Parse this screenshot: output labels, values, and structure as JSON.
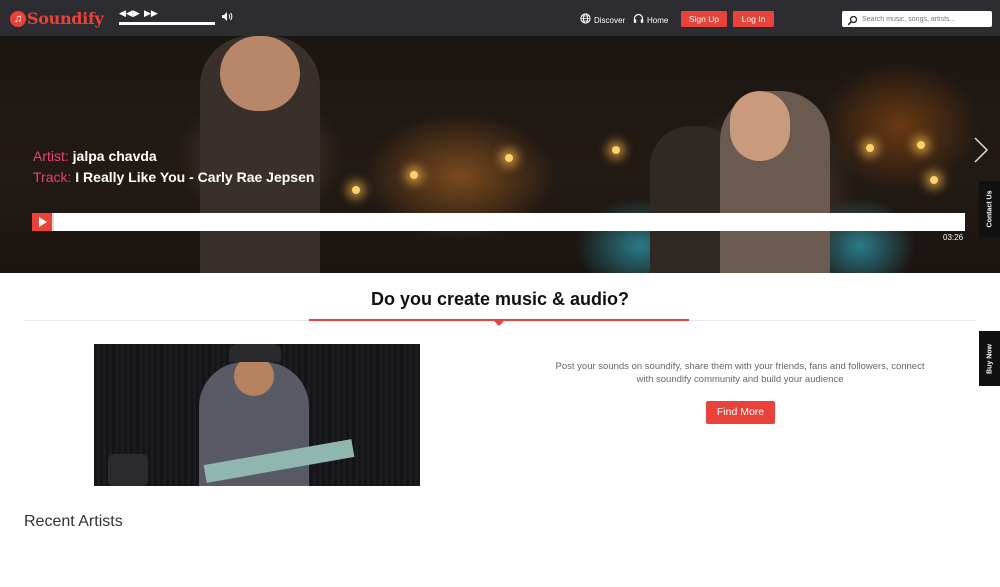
{
  "header": {
    "logo_text": "Soundify",
    "nav": [
      {
        "label": "Discover",
        "icon": "globe-icon"
      },
      {
        "label": "Home",
        "icon": "headphones-icon"
      }
    ],
    "signup_label": "Sign Up",
    "login_label": "Log In",
    "search_placeholder": "Search music, songs, artists..."
  },
  "player": {
    "artist_key": "Artist:",
    "artist_value": "jalpa chavda",
    "track_key": "Track:",
    "track_value": "I Really Like You - Carly Rae Jepsen",
    "duration": "03:26",
    "progress": 0
  },
  "side_tabs": {
    "contact": "Contact Us",
    "buy": "Buy Now"
  },
  "create": {
    "title": "Do you create music & audio?",
    "description": "Post your sounds on soundify, share them with your friends, fans and followers, connect with soundify community and build your audience",
    "button": "Find More"
  },
  "recent": {
    "title": "Recent Artists"
  },
  "colors": {
    "accent": "#e8423b",
    "topbar": "#2d2c31",
    "label_pink": "#e8427a"
  }
}
